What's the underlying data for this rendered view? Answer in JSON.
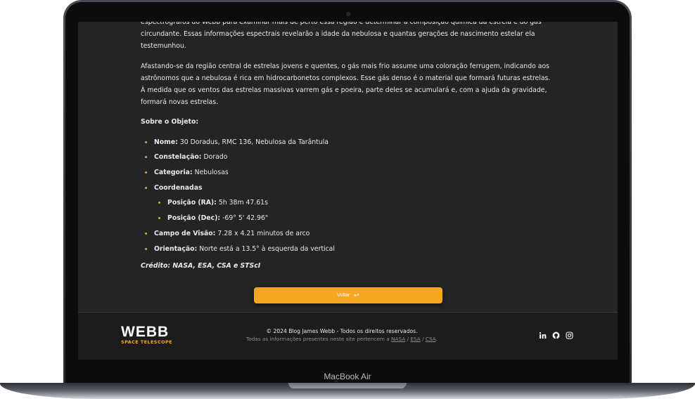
{
  "device": {
    "brand": "MacBook Air"
  },
  "article": {
    "paragraphs": [
      "espectrógrafos do Webb para examinar mais de perto essa região e determinar a composição química da estrela e do gás circundante. Essas informações espectrais revelarão a idade da nebulosa e quantas gerações de nascimento estelar ela testemunhou.",
      "Afastando-se da região central de estrelas jovens e quentes, o gás mais frio assume uma coloração ferrugem, indicando aos astrônomos que a nebulosa é rica em hidrocarbonetos complexos. Esse gás denso é o material que formará futuras estrelas. À medida que os ventos das estrelas massivas varrem gás e poeira, parte deles se acumulará e, com a ajuda da gravidade, formará novas estrelas."
    ],
    "about_title": "Sobre o Objeto:",
    "facts": {
      "name": {
        "label": "Nome:",
        "value": "30 Doradus, RMC 136, Nebulosa da Tarântula"
      },
      "constellation": {
        "label": "Constelação:",
        "value": "Dorado"
      },
      "category": {
        "label": "Categoria:",
        "value": "Nebulosas"
      },
      "coordinates": {
        "label": "Coordenadas"
      },
      "ra": {
        "label": "Posição (RA):",
        "value": "5h 38m 47.61s"
      },
      "dec": {
        "label": "Posição (Dec):",
        "value": "-69° 5' 42.96\""
      },
      "field": {
        "label": "Campo de Visão:",
        "value": "7.28 x 4.21 minutos de arco"
      },
      "orientation": {
        "label": "Orientação:",
        "value": "Norte está a 13.5° à esquerda da vertical"
      }
    },
    "credit": "Crédito: NASA, ESA, CSA e STScI"
  },
  "back_button": {
    "label": "Voltar",
    "icon": "return-arrow-icon",
    "color": "#f5a623"
  },
  "footer": {
    "logo_main": "WEBB",
    "logo_sub": "SPACE TELESCOPE",
    "copyright": "© 2024 Blog James Webb - Todos os direitos reservados.",
    "info_prefix": "Todas as informações presentes neste site pertencem a",
    "links": [
      "NASA",
      "ESA",
      "CSA"
    ],
    "sep": "/",
    "suffix": ".",
    "socials": [
      "linkedin-icon",
      "github-icon",
      "instagram-icon"
    ]
  },
  "colors": {
    "accent": "#f5a623",
    "background": "#242424",
    "footer": "#1c1c1c"
  }
}
